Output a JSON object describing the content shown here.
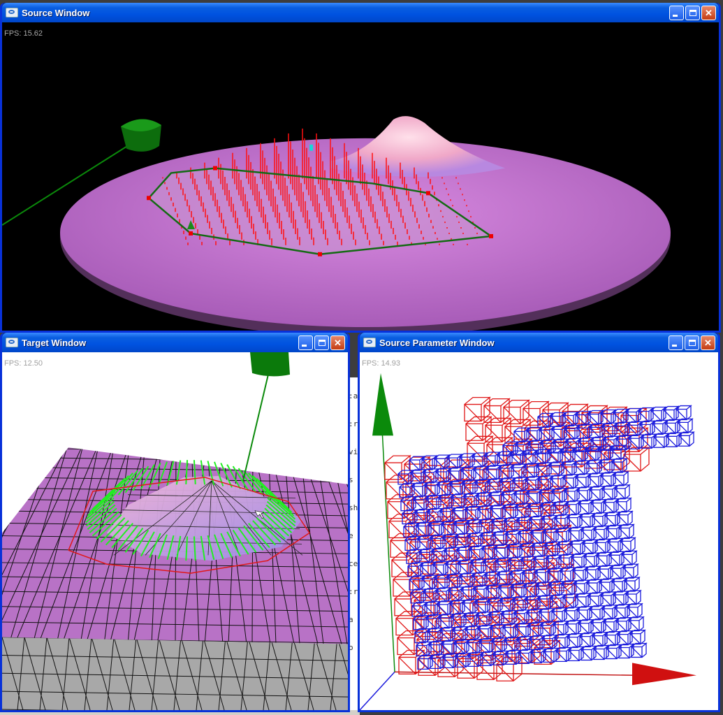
{
  "windows": {
    "source": {
      "title": "Source Window",
      "fps": "FPS: 15.62"
    },
    "target": {
      "title": "Target Window",
      "fps": "FPS: 12.50"
    },
    "param": {
      "title": "Source Parameter Window",
      "fps": "FPS: 14.93"
    }
  },
  "buttons": {
    "minimize": "",
    "maximize": "",
    "close": "✕"
  },
  "colors": {
    "titlebar": "#0052e0",
    "close_button": "#c43c12",
    "disc": "#b86cc4",
    "red_needles": "#ff1010",
    "green_axis": "#0b8a0b",
    "target_plane": "#b872c6",
    "target_gray": "#a8a8a8",
    "green_needles": "#22ee22",
    "grid_blue": "#1a1adc",
    "grid_red": "#e01818"
  },
  "background_text": [
    ":a",
    ":r",
    "vi",
    "s",
    "sh",
    "e",
    "ce",
    ":r",
    "a",
    "o"
  ]
}
